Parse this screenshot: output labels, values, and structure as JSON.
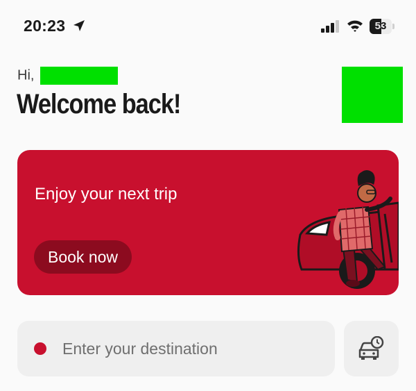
{
  "status_bar": {
    "time": "20:23",
    "battery_level": "53",
    "battery_fraction": 0.53,
    "icons": [
      "location-arrow-icon",
      "cellular-signal-icon",
      "wifi-icon",
      "battery-icon"
    ]
  },
  "header": {
    "greeting": "Hi,",
    "title": "Welcome back!"
  },
  "promo": {
    "title": "Enjoy your next trip",
    "button_label": "Book now",
    "illustration": "person-exiting-car-illustration"
  },
  "destination": {
    "placeholder": "Enter your destination",
    "schedule_icon": "car-clock-icon"
  },
  "colors": {
    "brand_red": "#c8102e",
    "button_dark_red": "#8c0b1f",
    "redaction_green": "#00e000",
    "field_bg": "#efefef"
  }
}
